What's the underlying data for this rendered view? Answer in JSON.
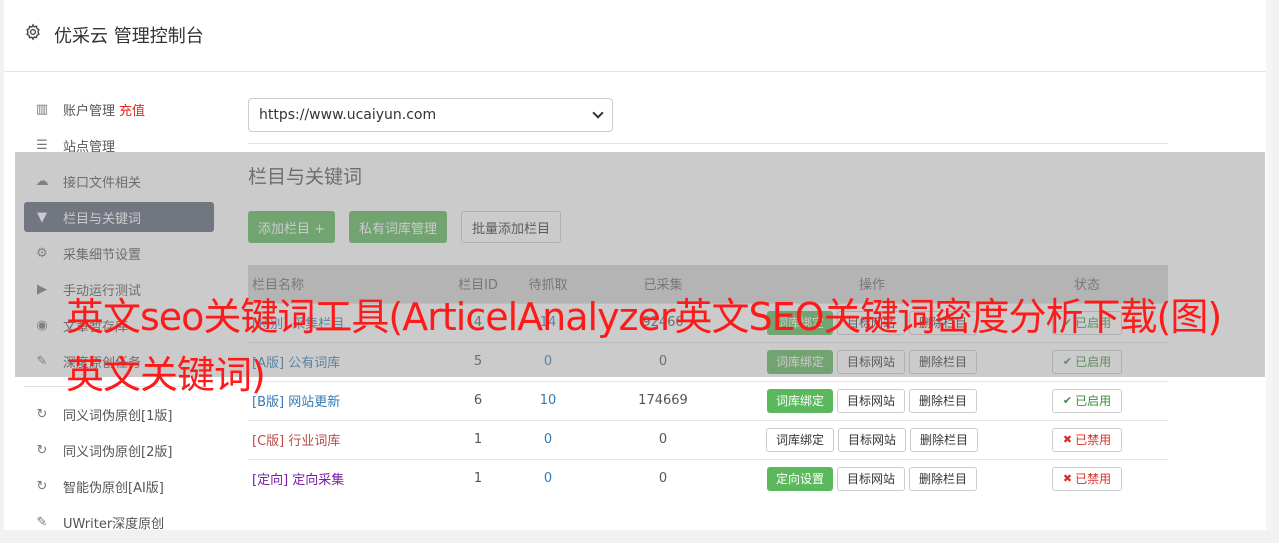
{
  "app": {
    "title": "优采云 管理控制台"
  },
  "sidebar": {
    "items": [
      {
        "label": "账户管理",
        "extra": "充值",
        "icon": "bar-chart-icon"
      },
      {
        "label": "站点管理",
        "icon": "server-icon"
      },
      {
        "label": "接口文件相关",
        "icon": "cloud-upload-icon"
      },
      {
        "label": "栏目与关键词",
        "icon": "filter-icon",
        "active": true
      },
      {
        "label": "采集细节设置",
        "icon": "gears-icon"
      },
      {
        "label": "手动运行测试",
        "icon": "play-circle-icon"
      },
      {
        "label": "文章暂存库",
        "icon": "database-icon"
      },
      {
        "label": "深度原创任务",
        "icon": "edit-icon"
      }
    ],
    "items2": [
      {
        "label": "同义词伪原创[1版]",
        "icon": "refresh-icon"
      },
      {
        "label": "同义词伪原创[2版]",
        "icon": "refresh-icon"
      },
      {
        "label": "智能伪原创[AI版]",
        "icon": "refresh-icon"
      },
      {
        "label": "UWriter深度原创",
        "icon": "edit-icon"
      }
    ]
  },
  "main": {
    "site_select": "https://www.ucaiyun.com",
    "section_title": "栏目与关键词",
    "buttons": {
      "add": "添加栏目 +",
      "private": "私有词库管理",
      "batch": "批量添加栏目"
    },
    "table": {
      "headers": [
        "栏目名称",
        "栏目ID",
        "待抓取",
        "已采集",
        "操作",
        "状态"
      ],
      "rows": [
        {
          "tag": "[特别]",
          "name": "采集栏目",
          "id": "4",
          "pending": "14",
          "done": "92460",
          "op1": "词库绑定",
          "op1_green": true,
          "op2": "目标网站",
          "op3": "删除栏目",
          "status": "已启用",
          "on": true
        },
        {
          "tag": "[A版]",
          "name": "公有词库",
          "id": "5",
          "pending": "0",
          "done": "0",
          "op1": "词库绑定",
          "op1_green": true,
          "op2": "目标网站",
          "op3": "删除栏目",
          "status": "已启用",
          "on": true
        },
        {
          "tag": "[B版]",
          "name": "网站更新",
          "id": "6",
          "pending": "10",
          "done": "174669",
          "op1": "词库绑定",
          "op1_green": true,
          "op2": "目标网站",
          "op3": "删除栏目",
          "status": "已启用",
          "on": true
        },
        {
          "tag": "[C版]",
          "name": "行业词库",
          "id": "1",
          "pending": "0",
          "done": "0",
          "op1": "词库绑定",
          "op1_green": false,
          "op2": "目标网站",
          "op3": "删除栏目",
          "status": "已禁用",
          "on": false
        },
        {
          "tag": "[定向]",
          "name": "定向采集",
          "id": "1",
          "pending": "0",
          "done": "0",
          "op1": "定向设置",
          "op1_green": true,
          "op2": "目标网站",
          "op3": "删除栏目",
          "status": "已禁用",
          "on": false
        }
      ]
    }
  },
  "overlay": {
    "headline": "英文seo关键词工具(ArticelAnalyzer英文SEO关键词密度分析下载(图)英文关键词)"
  },
  "colors": {
    "active_nav": "#5b6478",
    "green": "#5cb85c",
    "red_text": "#ff1a1a",
    "link_blue": "#337ab7"
  }
}
